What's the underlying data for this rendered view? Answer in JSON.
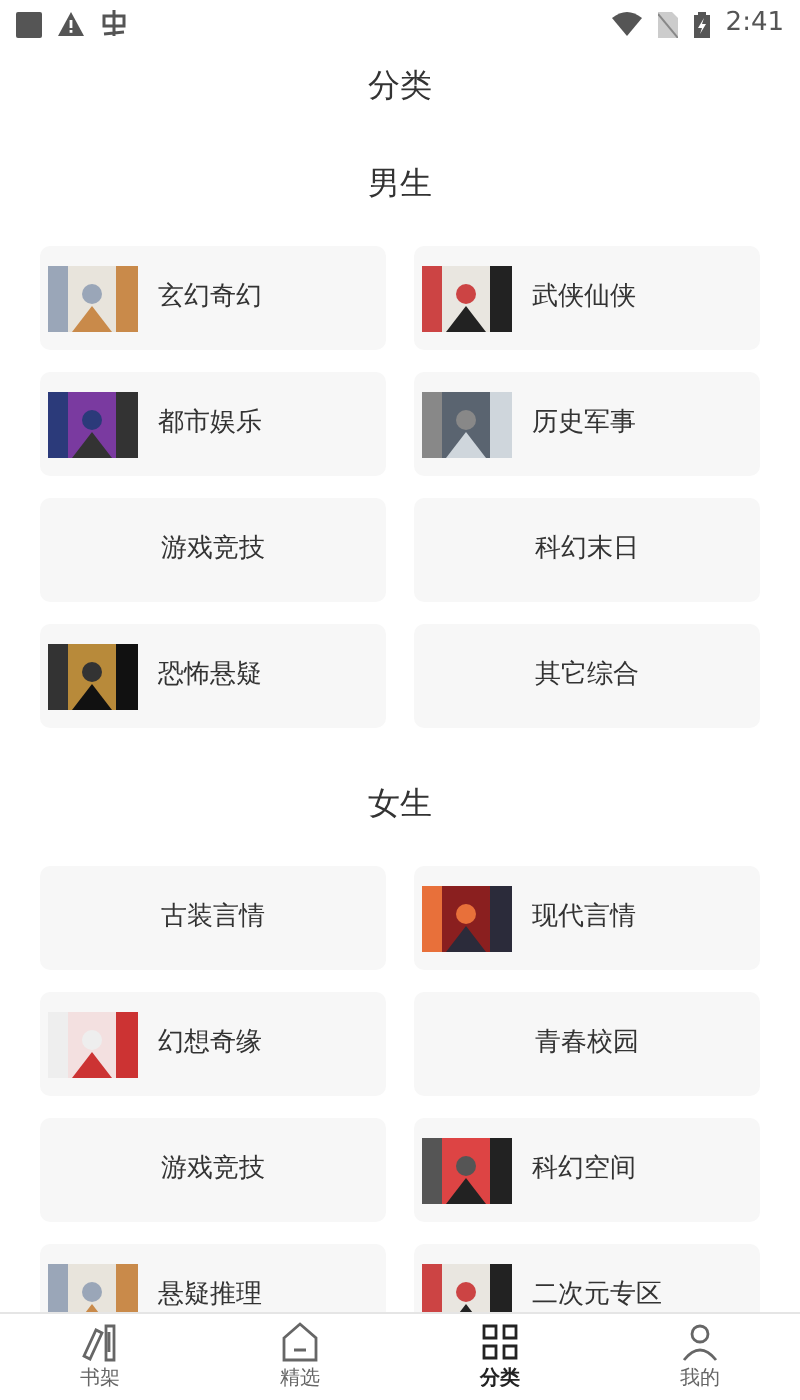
{
  "status_bar": {
    "time": "2:41"
  },
  "title": "分类",
  "sections": [
    {
      "heading": "男生",
      "categories": [
        {
          "label": "玄幻奇幻",
          "has_cover": true
        },
        {
          "label": "武侠仙侠",
          "has_cover": true
        },
        {
          "label": "都市娱乐",
          "has_cover": true
        },
        {
          "label": "历史军事",
          "has_cover": true
        },
        {
          "label": "游戏竞技",
          "has_cover": false
        },
        {
          "label": "科幻末日",
          "has_cover": false
        },
        {
          "label": "恐怖悬疑",
          "has_cover": true
        },
        {
          "label": "其它综合",
          "has_cover": false
        }
      ]
    },
    {
      "heading": "女生",
      "categories": [
        {
          "label": "古装言情",
          "has_cover": false
        },
        {
          "label": "现代言情",
          "has_cover": true
        },
        {
          "label": "幻想奇缘",
          "has_cover": true
        },
        {
          "label": "青春校园",
          "has_cover": false
        },
        {
          "label": "游戏竞技",
          "has_cover": false
        },
        {
          "label": "科幻空间",
          "has_cover": true
        },
        {
          "label": "悬疑推理",
          "has_cover": true
        },
        {
          "label": "二次元专区",
          "has_cover": true
        }
      ]
    }
  ],
  "bottom_nav": [
    {
      "label": "书架",
      "selected": false
    },
    {
      "label": "精选",
      "selected": false
    },
    {
      "label": "分类",
      "selected": true
    },
    {
      "label": "我的",
      "selected": false
    }
  ]
}
